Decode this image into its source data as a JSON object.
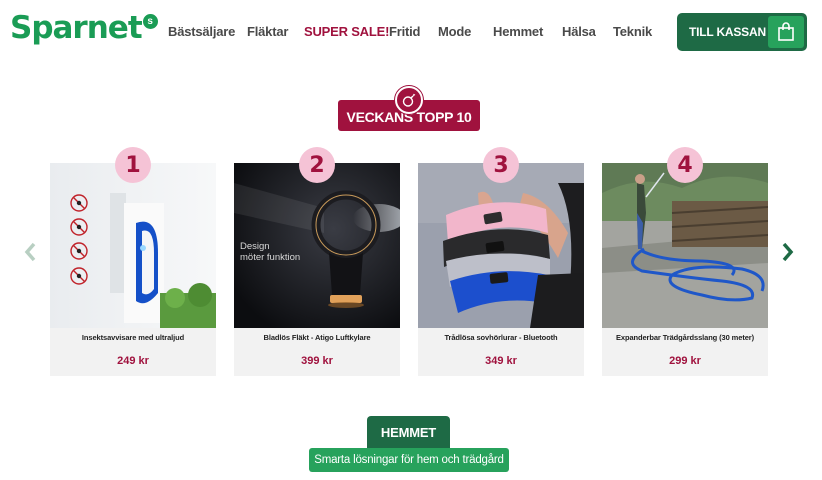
{
  "header": {
    "logo_text": "Sparnet",
    "logo_badge": "s",
    "nav": [
      {
        "label": "Bästsäljare",
        "sale": false
      },
      {
        "label": "Fläktar",
        "sale": false
      },
      {
        "label": "SUPER SALE!",
        "sale": true
      },
      {
        "label": "Fritid",
        "sale": false
      },
      {
        "label": "Mode",
        "sale": false
      },
      {
        "label": "Hemmet",
        "sale": false
      },
      {
        "label": "Hälsa",
        "sale": false
      },
      {
        "label": "Teknik",
        "sale": false
      }
    ],
    "cart_label": "TILL KASSAN",
    "cart_icon": "shopping-bag-icon"
  },
  "top10": {
    "title": "VECKANS TOPP 10",
    "icon": "bomb-icon"
  },
  "carousel": {
    "prev_icon": "chevron-left-icon",
    "next_icon": "chevron-right-icon",
    "products": [
      {
        "rank": "1",
        "name": "Insektsavvisare med ultraljud",
        "price": "249 kr"
      },
      {
        "rank": "2",
        "name": "Bladlös Fläkt - Atigo Luftkylare",
        "price": "399 kr",
        "image_text_1": "Design",
        "image_text_2": "möter funktion"
      },
      {
        "rank": "3",
        "name": "Trådlösa sovhörlurar - Bluetooth",
        "price": "349 kr"
      },
      {
        "rank": "4",
        "name": "Expanderbar Trädgårdsslang (30 meter)",
        "price": "299 kr"
      }
    ]
  },
  "hemmet": {
    "title": "HEMMET",
    "subtitle": "Smarta lösningar för hem och trädgård"
  },
  "colors": {
    "brand_green": "#1a9c55",
    "dark_green": "#1e6a45",
    "sale_red": "#a0123e",
    "rank_pink": "#f5c3d6"
  }
}
